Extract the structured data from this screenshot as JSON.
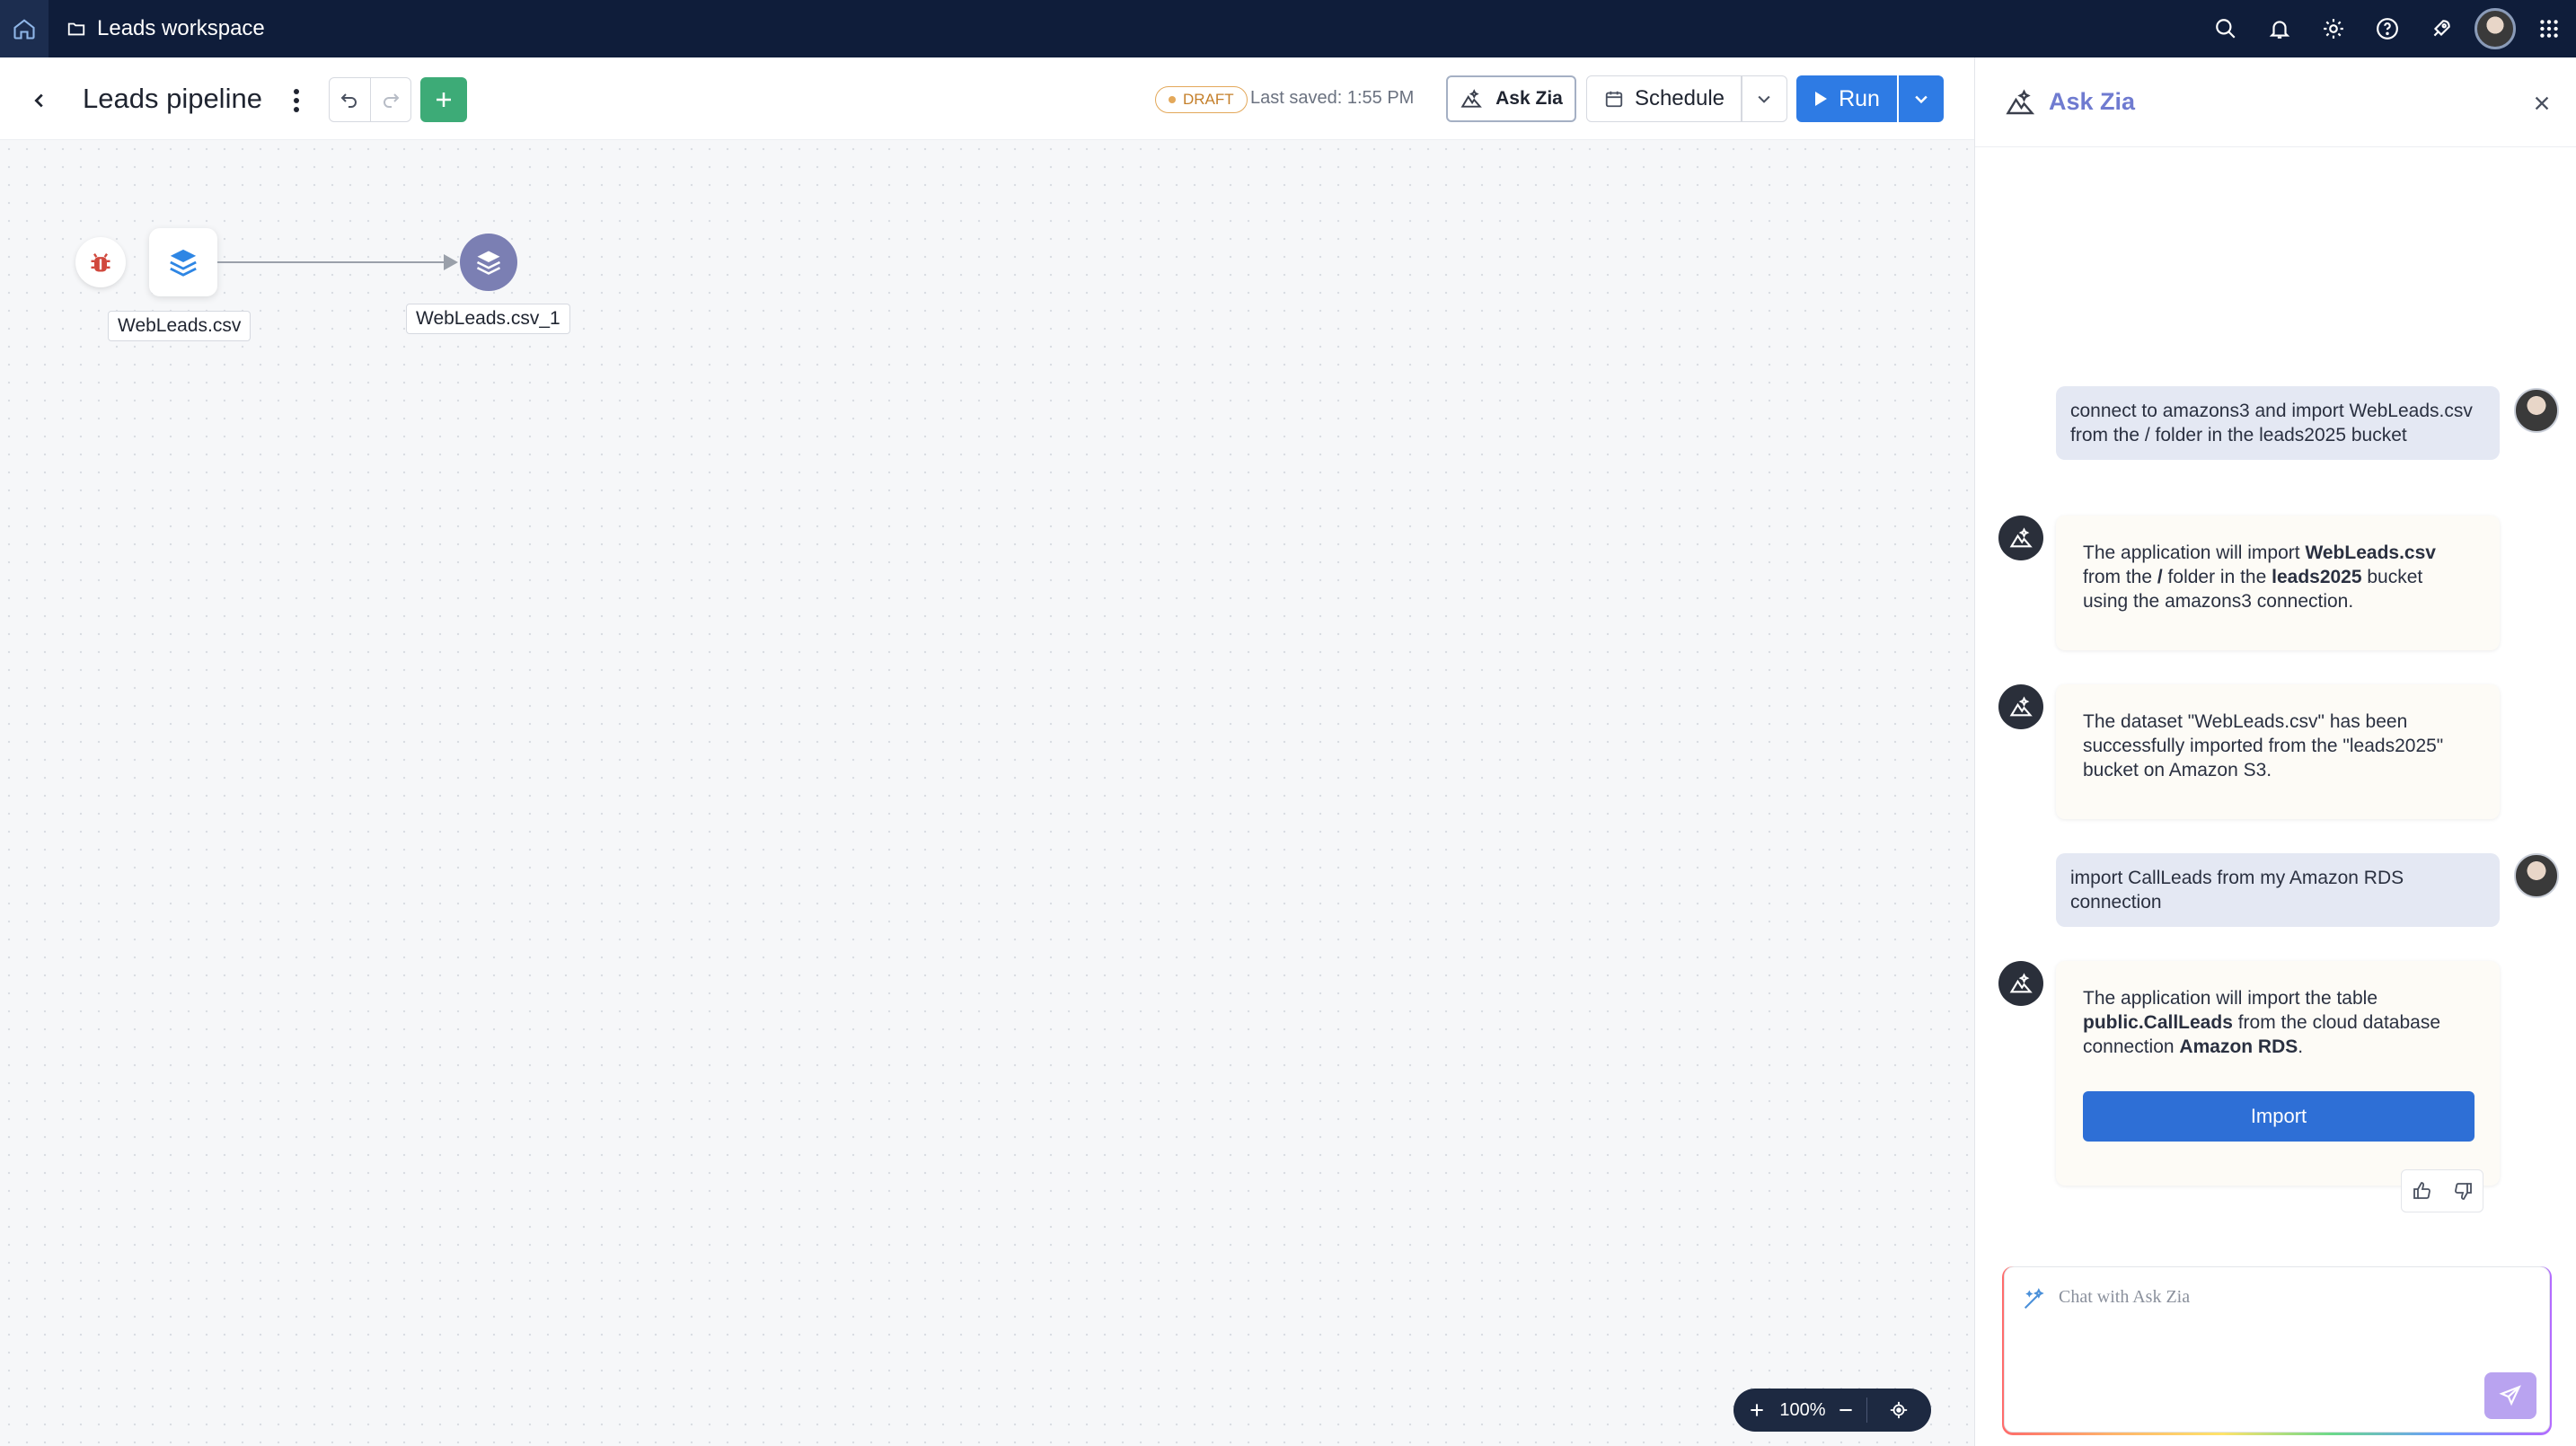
{
  "topbar": {
    "workspace_title": "Leads workspace",
    "icons": [
      "home-icon",
      "folder-icon",
      "search-icon",
      "bell-icon",
      "gear-icon",
      "help-icon",
      "rocket-icon",
      "avatar",
      "apps-grid-icon"
    ]
  },
  "toolbar": {
    "pipeline_title": "Leads pipeline",
    "draft_label": "DRAFT",
    "last_saved": "Last saved: 1:55 PM",
    "ask_zia_label": "Ask Zia",
    "schedule_label": "Schedule",
    "run_label": "Run"
  },
  "canvas": {
    "source_node_label": "WebLeads.csv",
    "target_node_label": "WebLeads.csv_1",
    "zoom_level": "100%"
  },
  "panel": {
    "title": "Ask Zia",
    "messages": [
      {
        "role": "user",
        "text": "connect to amazons3 and import WebLeads.csv from the / folder in the leads2025 bucket"
      },
      {
        "role": "bot",
        "parts": [
          "The application will import ",
          "WebLeads.csv",
          " from the ",
          "/",
          " folder in the ",
          "leads2025",
          " bucket using the amazons3 connection."
        ]
      },
      {
        "role": "bot",
        "text": "The dataset \"WebLeads.csv\" has been successfully imported from the \"leads2025\" bucket on Amazon S3."
      },
      {
        "role": "user",
        "text": "import CallLeads from my Amazon RDS connection"
      },
      {
        "role": "bot",
        "parts": [
          "The application will import the table ",
          "public.CallLeads",
          " from the cloud database connection ",
          "Amazon RDS",
          "."
        ],
        "button_label": "Import"
      }
    ],
    "chat_placeholder": "Chat with Ask Zia"
  },
  "colors": {
    "topbar_bg": "#0f1d3a",
    "accent_blue": "#2e7be4",
    "add_green": "#3dab77",
    "zia_purple": "#6f7bd0",
    "draft_orange": "#e3a85a"
  }
}
